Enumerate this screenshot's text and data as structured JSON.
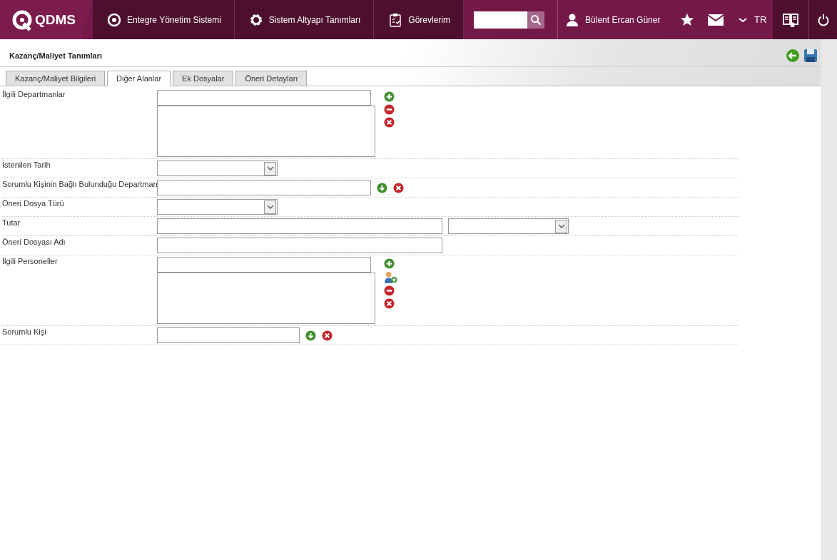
{
  "topbar": {
    "logo": "QDMS",
    "nav": [
      {
        "label": "Entegre Yönetim Sistemi",
        "kind": "q"
      },
      {
        "label": "Sistem Altyapı Tanımları",
        "kind": "gear"
      },
      {
        "label": "Görevlerim",
        "kind": "tasks"
      }
    ],
    "user": "Bülent Ercan Güner",
    "language": "TR"
  },
  "page": {
    "title": "Kazanç/Maliyet Tanımları"
  },
  "tabs": [
    {
      "label": "Kazanç/Maliyet Bilgileri",
      "selected": false
    },
    {
      "label": "Diğer Alanlar",
      "selected": true
    },
    {
      "label": "Ek Dosyalar",
      "selected": false
    },
    {
      "label": "Öneri Detayları",
      "selected": false
    }
  ],
  "fields": [
    {
      "label": "İlgili Departmanlar",
      "kind": "multi"
    },
    {
      "label": "İstenilen Tarih",
      "kind": "select"
    },
    {
      "label": "Sorumlu Kişinin Bağlı Bulunduğu Departman",
      "kind": "lookup"
    },
    {
      "label": "Öneri Dosya Türü",
      "kind": "select"
    },
    {
      "label": "Tutar",
      "kind": "amount"
    },
    {
      "label": "Öneri Dosyası Adı",
      "kind": "text"
    },
    {
      "label": "İlgili Personeller",
      "kind": "multi_person"
    },
    {
      "label": "Sorumlu Kişi",
      "kind": "lookup_short"
    }
  ]
}
